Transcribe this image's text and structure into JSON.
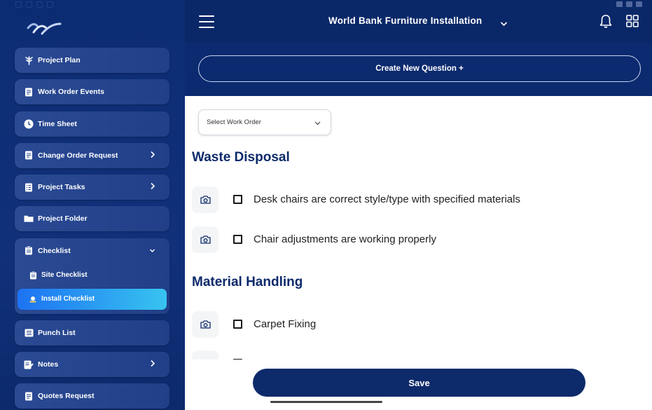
{
  "app": {
    "project_title": "World Bank Furniture Installation"
  },
  "header": {
    "create_button_label": "Create New Question +"
  },
  "sidebar": {
    "items": [
      {
        "label": "Project Plan",
        "icon": "tree-icon"
      },
      {
        "label": "Work Order Events",
        "icon": "document-icon"
      },
      {
        "label": "Time Sheet",
        "icon": "clock-icon"
      },
      {
        "label": "Change Order Request",
        "icon": "document-icon",
        "has_chevron": true
      },
      {
        "label": "Project Tasks",
        "icon": "tasks-icon",
        "has_chevron": true
      },
      {
        "label": "Project Folder",
        "icon": "folder-icon"
      }
    ],
    "checklist": {
      "label": "Checklist",
      "icon": "clipboard-icon",
      "expanded": true,
      "sub_items": [
        {
          "label": "Site Checklist",
          "icon": "clipboard-icon",
          "active": false
        },
        {
          "label": "Install Checklist",
          "icon": "install-icon",
          "active": true
        }
      ]
    },
    "items_after": [
      {
        "label": "Punch List",
        "icon": "list-icon"
      },
      {
        "label": "Notes",
        "icon": "notes-icon",
        "has_chevron": true
      },
      {
        "label": "Quotes Request",
        "icon": "document-icon"
      }
    ]
  },
  "filter": {
    "select_work_order": "Select Work Order"
  },
  "sections": [
    {
      "title": "Waste Disposal",
      "questions": [
        {
          "text": "Desk chairs are correct style/type with specified materials",
          "checked": false
        },
        {
          "text": "Chair adjustments are working properly",
          "checked": false
        }
      ]
    },
    {
      "title": "Material Handling",
      "questions": [
        {
          "text": "Carpet Fixing",
          "checked": false
        }
      ]
    }
  ],
  "footer": {
    "save_label": "Save"
  },
  "colors": {
    "navy": "#0b2a6f",
    "sidebar_item": "#243f88",
    "active_gradient_start": "#1d72f2",
    "active_gradient_end": "#37c4f0",
    "save_button": "#0d2a6a"
  }
}
